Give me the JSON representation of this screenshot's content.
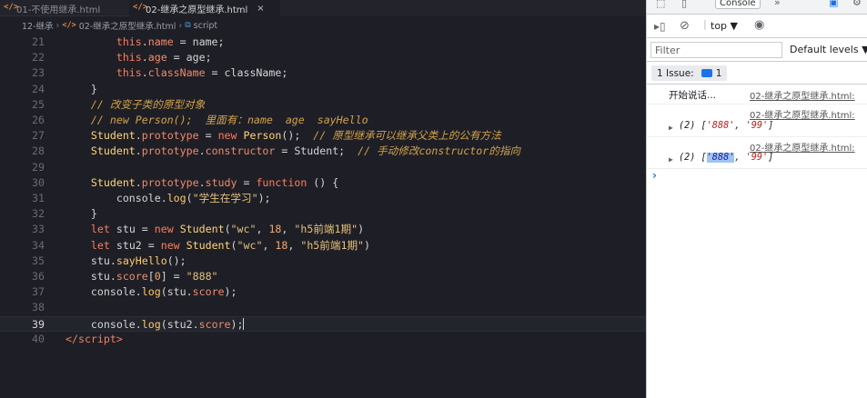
{
  "editor": {
    "tabs": [
      {
        "icon": "</>",
        "label": "01-不使用继承.html",
        "active": false
      },
      {
        "icon": "</>",
        "label": "02-继承之原型继承.html",
        "active": true,
        "close": "×"
      }
    ],
    "breadcrumb": {
      "folder": "12-继承",
      "file_icon": "</>",
      "file": "02-继承之原型继承.html",
      "symbol": "script"
    },
    "current_line": "39",
    "lines": [
      {
        "num": "21",
        "tokens": [
          [
            "pl",
            "        "
          ],
          [
            "k",
            "this"
          ],
          [
            "pl",
            "."
          ],
          [
            "p",
            "name"
          ],
          [
            "pl",
            " = name;"
          ]
        ]
      },
      {
        "num": "22",
        "tokens": [
          [
            "pl",
            "        "
          ],
          [
            "k",
            "this"
          ],
          [
            "pl",
            "."
          ],
          [
            "p",
            "age"
          ],
          [
            "pl",
            " = age;"
          ]
        ]
      },
      {
        "num": "23",
        "tokens": [
          [
            "pl",
            "        "
          ],
          [
            "k",
            "this"
          ],
          [
            "pl",
            "."
          ],
          [
            "p",
            "className"
          ],
          [
            "pl",
            " = className;"
          ]
        ]
      },
      {
        "num": "24",
        "tokens": [
          [
            "pl",
            "    }"
          ]
        ]
      },
      {
        "num": "25",
        "tokens": [
          [
            "pl",
            "    "
          ],
          [
            "c",
            "// 改变子类的原型对象"
          ]
        ]
      },
      {
        "num": "26",
        "tokens": [
          [
            "pl",
            "    "
          ],
          [
            "c",
            "// new Person();  里面有：name  age  sayHello"
          ]
        ]
      },
      {
        "num": "27",
        "tokens": [
          [
            "pl",
            "    "
          ],
          [
            "cls",
            "Student"
          ],
          [
            "pl",
            "."
          ],
          [
            "p",
            "prototype"
          ],
          [
            "pl",
            " = "
          ],
          [
            "k",
            "new"
          ],
          [
            "pl",
            " "
          ],
          [
            "cls",
            "Person"
          ],
          [
            "pl",
            "();  "
          ],
          [
            "c",
            "// 原型继承可以继承父类上的公有方法"
          ]
        ]
      },
      {
        "num": "28",
        "tokens": [
          [
            "pl",
            "    "
          ],
          [
            "cls",
            "Student"
          ],
          [
            "pl",
            "."
          ],
          [
            "p",
            "prototype"
          ],
          [
            "pl",
            "."
          ],
          [
            "p",
            "constructor"
          ],
          [
            "pl",
            " = Student;  "
          ],
          [
            "c",
            "// 手动修改constructor的指向"
          ]
        ]
      },
      {
        "num": "29",
        "tokens": [
          [
            "pl",
            ""
          ]
        ]
      },
      {
        "num": "30",
        "tokens": [
          [
            "pl",
            "    "
          ],
          [
            "cls",
            "Student"
          ],
          [
            "pl",
            "."
          ],
          [
            "p",
            "prototype"
          ],
          [
            "pl",
            "."
          ],
          [
            "p",
            "study"
          ],
          [
            "pl",
            " = "
          ],
          [
            "k",
            "function"
          ],
          [
            "pl",
            " () {"
          ]
        ]
      },
      {
        "num": "31",
        "tokens": [
          [
            "pl",
            "        console."
          ],
          [
            "f",
            "log"
          ],
          [
            "pl",
            "("
          ],
          [
            "s",
            "\"学生在学习\""
          ],
          [
            "pl",
            ");"
          ]
        ]
      },
      {
        "num": "32",
        "tokens": [
          [
            "pl",
            "    }"
          ]
        ]
      },
      {
        "num": "33",
        "tokens": [
          [
            "pl",
            "    "
          ],
          [
            "k",
            "let"
          ],
          [
            "pl",
            " stu = "
          ],
          [
            "k",
            "new"
          ],
          [
            "pl",
            " "
          ],
          [
            "cls",
            "Student"
          ],
          [
            "pl",
            "("
          ],
          [
            "s",
            "\"wc\""
          ],
          [
            "pl",
            ", "
          ],
          [
            "n",
            "18"
          ],
          [
            "pl",
            ", "
          ],
          [
            "s",
            "\"h5前端1期\""
          ],
          [
            "pl",
            ")"
          ]
        ]
      },
      {
        "num": "34",
        "tokens": [
          [
            "pl",
            "    "
          ],
          [
            "k",
            "let"
          ],
          [
            "pl",
            " stu2 = "
          ],
          [
            "k",
            "new"
          ],
          [
            "pl",
            " "
          ],
          [
            "cls",
            "Student"
          ],
          [
            "pl",
            "("
          ],
          [
            "s",
            "\"wc\""
          ],
          [
            "pl",
            ", "
          ],
          [
            "n",
            "18"
          ],
          [
            "pl",
            ", "
          ],
          [
            "s",
            "\"h5前端1期\""
          ],
          [
            "pl",
            ")"
          ]
        ]
      },
      {
        "num": "35",
        "tokens": [
          [
            "pl",
            "    stu."
          ],
          [
            "f",
            "sayHello"
          ],
          [
            "pl",
            "();"
          ]
        ]
      },
      {
        "num": "36",
        "tokens": [
          [
            "pl",
            "    stu."
          ],
          [
            "p",
            "score"
          ],
          [
            "pl",
            "["
          ],
          [
            "n",
            "0"
          ],
          [
            "pl",
            "] = "
          ],
          [
            "s",
            "\"888\""
          ]
        ]
      },
      {
        "num": "37",
        "tokens": [
          [
            "pl",
            "    console."
          ],
          [
            "f",
            "log"
          ],
          [
            "pl",
            "(stu."
          ],
          [
            "p",
            "score"
          ],
          [
            "pl",
            ");"
          ]
        ]
      },
      {
        "num": "38",
        "tokens": [
          [
            "pl",
            ""
          ]
        ]
      },
      {
        "num": "39",
        "tokens": [
          [
            "pl",
            "    console."
          ],
          [
            "f",
            "log"
          ],
          [
            "pl",
            "(stu2."
          ],
          [
            "p",
            "score"
          ],
          [
            "pl",
            ");"
          ]
        ]
      },
      {
        "num": "40",
        "tokens": [
          [
            "tag",
            "</"
          ],
          [
            "tag",
            "script"
          ],
          [
            "tag",
            ">"
          ]
        ]
      }
    ]
  },
  "devtools": {
    "tab_label": "Console",
    "toolbar": {
      "context": "top"
    },
    "filter_placeholder": "Filter",
    "levels_label": "Default levels ▼",
    "issues_label": "1 Issue:",
    "issues_count": "1",
    "messages": [
      {
        "text": "开始说话...",
        "source": "02-继承之原型继承.html:"
      },
      {
        "prefix": "(2) [",
        "items": [
          "'888'",
          "'99'"
        ],
        "suffix": "]",
        "source": "02-继承之原型继承.html:"
      },
      {
        "prefix": "(2) [",
        "items": [
          "'888'",
          "'99'"
        ],
        "suffix": "]",
        "source": "02-继承之原型继承.html:"
      }
    ],
    "prompt": "›",
    "colors": {
      "link": "#545454",
      "string": "#c41a16",
      "accent": "#1a73e8"
    }
  }
}
